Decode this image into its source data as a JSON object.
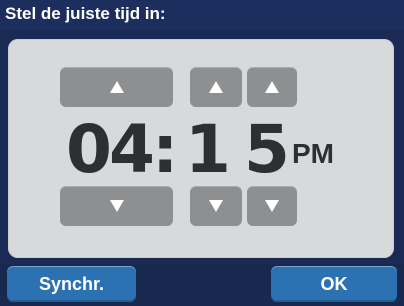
{
  "title": "Stel de juiste tijd in:",
  "time": {
    "hour_tens": "0",
    "hour_ones": "4",
    "separator": ":",
    "minute_tens": "1",
    "minute_ones": "5",
    "period": "PM"
  },
  "buttons": {
    "sync_label": "Synchr.",
    "ok_label": "OK"
  },
  "icons": {
    "up": "up-arrow-icon",
    "down": "down-arrow-icon"
  },
  "colors": {
    "title_bar": "#1b2e5e",
    "panel": "#d7d9da",
    "arrow_button": "#8d8f90",
    "action_button": "#2c72b3",
    "digits": "#2e2f31"
  }
}
